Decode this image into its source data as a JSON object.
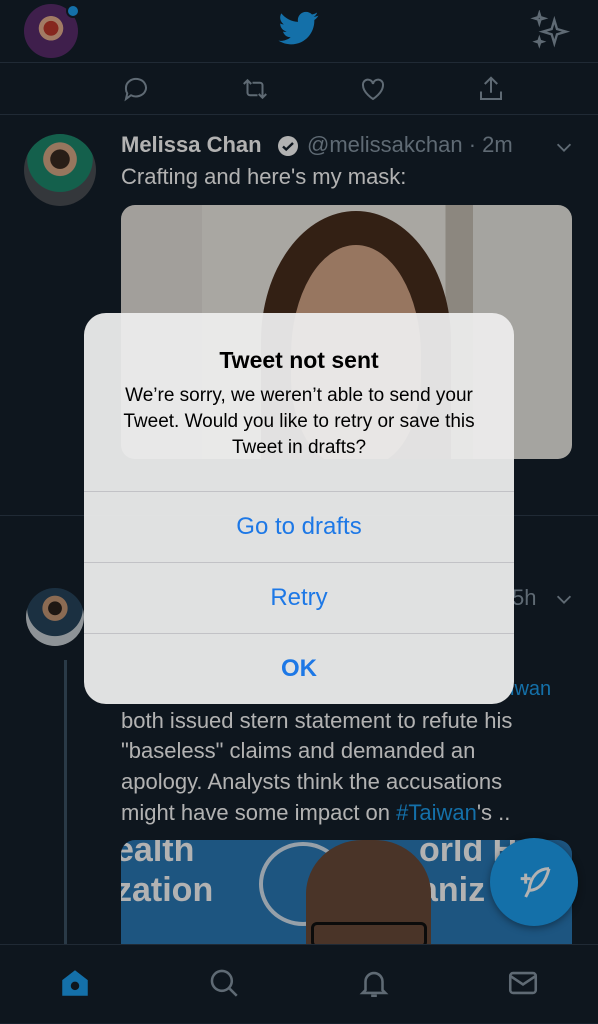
{
  "header": {
    "avatar": "user-avatar",
    "logo_icon": "twitter-bird-icon",
    "sparkle_icon": "sparkle-icon"
  },
  "tweet1": {
    "name": "Melissa Chan",
    "handle": "@melissakchan · 2m",
    "text": "Crafting and here's my mask:"
  },
  "tweet2": {
    "time": "5h",
    "hashtag_fragment": "iwan",
    "lines": [
      "both issued stern statement to refute his",
      "\"baseless\" claims and demanded an",
      "apology. Analysts think the accusations"
    ],
    "last_line_prefix": "might have some impact on ",
    "last_line_hashtag": "#Taiwan",
    "last_line_suffix": "'s ..",
    "image_text_left_1": "ealth",
    "image_text_left_2": "zation",
    "image_text_right_1": "orld He",
    "image_text_right_2": "aniz"
  },
  "alert": {
    "title": "Tweet not sent",
    "message": "We’re sorry, we weren’t able to send your Tweet. Would you like to retry or save this Tweet in drafts?",
    "buttons": [
      "Go to drafts",
      "Retry",
      "OK"
    ]
  },
  "colors": {
    "accent": "#1da1f2",
    "background": "#15202b",
    "alert_button": "#1d78e6"
  }
}
